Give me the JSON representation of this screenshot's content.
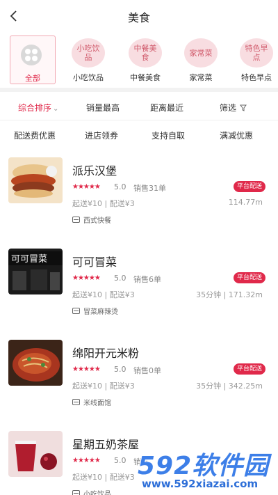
{
  "header": {
    "title": "美食",
    "back_icon": "chevron-left-icon"
  },
  "categories": [
    {
      "icon_text": "",
      "label": "全部",
      "active": true
    },
    {
      "icon_text": "小吃饮品",
      "label": "小吃饮品",
      "active": false
    },
    {
      "icon_text": "中餐美食",
      "label": "中餐美食",
      "active": false
    },
    {
      "icon_text": "家常菜",
      "label": "家常菜",
      "active": false
    },
    {
      "icon_text": "特色早点",
      "label": "特色早点",
      "active": false
    }
  ],
  "sort_bar": {
    "items": [
      "综合排序",
      "销量最高",
      "距离最近",
      "筛选"
    ],
    "active_index": 0
  },
  "filter_bar": {
    "items": [
      "配送费优惠",
      "进店领券",
      "支持自取",
      "满减优惠"
    ]
  },
  "shops": [
    {
      "name": "派乐汉堡",
      "rating": "5.0",
      "sales": "销售31单",
      "badge": "平台配送",
      "min_order": "起送¥10",
      "delivery_fee": "配送¥3",
      "distance": "114.77m",
      "tag": "西式快餐"
    },
    {
      "name": "可可冒菜",
      "rating": "5.0",
      "sales": "销售6单",
      "badge": "平台配送",
      "min_order": "起送¥10",
      "delivery_fee": "配送¥3",
      "distance": "35分钟 | 171.32m",
      "tag": "冒菜麻辣烫"
    },
    {
      "name": "绵阳开元米粉",
      "rating": "5.0",
      "sales": "销售0单",
      "badge": "平台配送",
      "min_order": "起送¥10",
      "delivery_fee": "配送¥3",
      "distance": "35分钟 | 342.25m",
      "tag": "米线面馆"
    },
    {
      "name": "星期五奶茶屋",
      "rating": "5.0",
      "sales": "销售",
      "badge": "",
      "min_order": "起送¥10",
      "delivery_fee": "配送¥3",
      "distance": "",
      "tag": "小吃饮品"
    }
  ],
  "watermark": {
    "big": "592软件园",
    "small": "www.592xiazai.com"
  },
  "colors": {
    "accent": "#e0294a",
    "category_bg": "#f8dde1"
  }
}
